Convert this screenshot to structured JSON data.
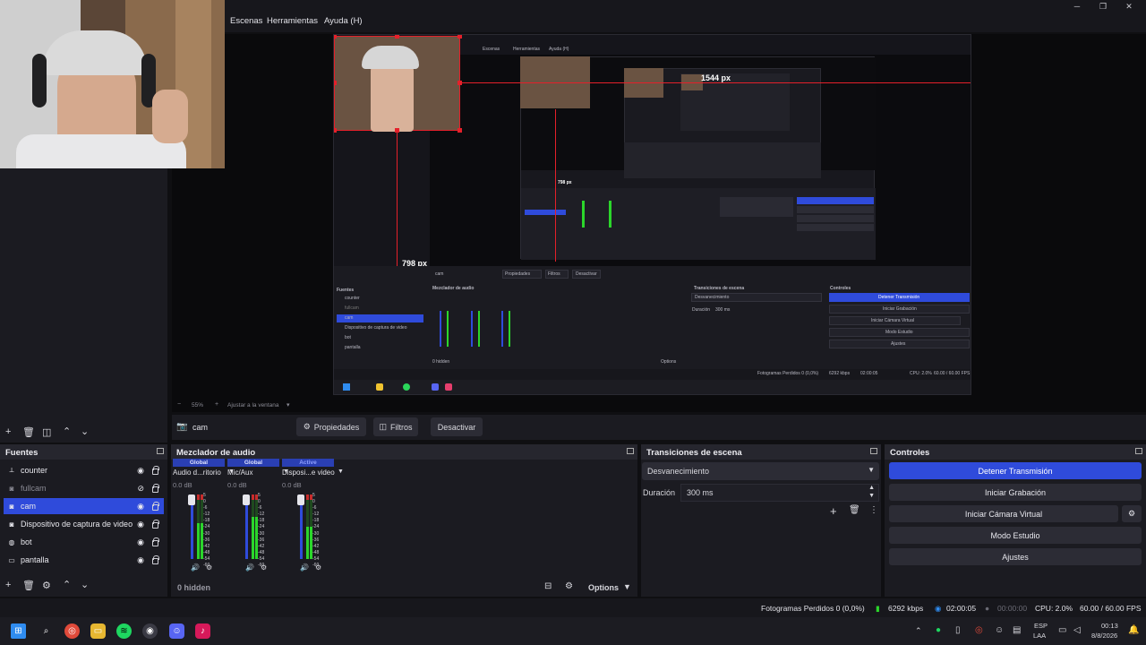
{
  "menu": {
    "escenas": "Escenas",
    "herramientas": "Herramientas",
    "ayuda": "Ayuda (H)"
  },
  "window": {
    "minimize": "─",
    "maximize": "❐",
    "close": "✕"
  },
  "preview": {
    "dim_width": "1544 px",
    "dim_height": "798 px",
    "zoom": "55%",
    "zoom_fit": "Ajustar a la ventana"
  },
  "source_bar": {
    "current_source": "cam",
    "properties": "Propiedades",
    "filters": "Filtros",
    "deactivate": "Desactivar"
  },
  "sources": {
    "title": "Fuentes",
    "items": [
      {
        "label": "counter",
        "icon": "link-icon",
        "visible": true,
        "dim": false,
        "selected": false
      },
      {
        "label": "fullcam",
        "icon": "camera-icon",
        "visible": false,
        "dim": true,
        "selected": false
      },
      {
        "label": "cam",
        "icon": "camera-icon",
        "visible": true,
        "dim": false,
        "selected": true
      },
      {
        "label": "Dispositivo de captura de video",
        "icon": "camera-icon",
        "visible": true,
        "dim": false,
        "selected": false
      },
      {
        "label": "bot",
        "icon": "globe-icon",
        "visible": true,
        "dim": false,
        "selected": false
      },
      {
        "label": "pantalla",
        "icon": "monitor-icon",
        "visible": true,
        "dim": false,
        "selected": false
      }
    ]
  },
  "mixer": {
    "title": "Mezclador de audio",
    "hidden": "0 hidden",
    "options": "Options",
    "channels": [
      {
        "badge": "Global",
        "name": "Audio d...ritorio",
        "db": "0.0 dB",
        "level": 0.55,
        "active": false
      },
      {
        "badge": "Global",
        "name": "Mic/Aux",
        "db": "0.0 dB",
        "level": 0.65,
        "active": false
      },
      {
        "badge": "Active",
        "name": "Disposi...e video",
        "db": "0.0 dB",
        "level": 0.5,
        "active": true
      }
    ],
    "ticks": [
      "5",
      "0",
      "-6",
      "-12",
      "-18",
      "-24",
      "-30",
      "-36",
      "-42",
      "-48",
      "-54",
      "-60"
    ]
  },
  "transitions": {
    "title": "Transiciones de escena",
    "selected": "Desvanecimiento",
    "duration_label": "Duración",
    "duration_value": "300 ms"
  },
  "controls": {
    "title": "Controles",
    "stop_stream": "Detener Transmisión",
    "start_recording": "Iniciar Grabación",
    "start_virtual_cam": "Iniciar Cámara Virtual",
    "studio_mode": "Modo Estudio",
    "settings": "Ajustes"
  },
  "status": {
    "dropped_frames": "Fotogramas Perdidos 0 (0,0%)",
    "bitrate": "6292 kbps",
    "stream_time": "02:00:05",
    "rec_time": "00:00:00",
    "cpu": "CPU: 2.0%",
    "fps": "60.00 / 60.00 FPS"
  },
  "taskbar": {
    "lang_top": "ESP",
    "lang_bottom": "LAA",
    "time": "00:13",
    "date": "8/8/2026"
  },
  "colors": {
    "accent": "#2f4bdb",
    "selection_red": "#e5202a",
    "bg": "#1b1b21"
  }
}
